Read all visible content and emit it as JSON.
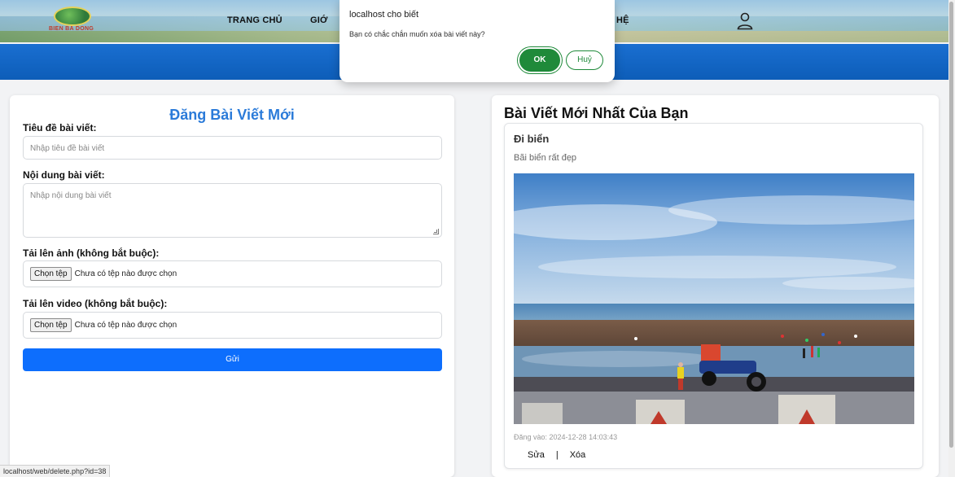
{
  "header": {
    "logo_text": "BIEN BA DONG",
    "nav": [
      "TRANG CHỦ",
      "GIỚ",
      "HỆ"
    ]
  },
  "form": {
    "title": "Đăng Bài Viết Mới",
    "title_label": "Tiêu đề bài viết:",
    "title_placeholder": "Nhập tiêu đề bài viết",
    "content_label": "Nội dung bài viết:",
    "content_placeholder": "Nhập nội dung bài viết",
    "image_label": "Tải lên ảnh (không bắt buộc):",
    "video_label": "Tải lên video (không bắt buộc):",
    "file_button": "Chọn tệp",
    "file_status": "Chưa có tệp nào được chọn",
    "submit_label": "Gửi"
  },
  "recent": {
    "heading": "Bài Viết Mới Nhất Của Bạn",
    "post": {
      "title": "Đi biển",
      "body": "Bãi biển rất đẹp",
      "date": "Đăng vào: 2024-12-28 14:03:43",
      "edit_label": "Sửa",
      "separator": "|",
      "delete_label": "Xóa"
    }
  },
  "dialog": {
    "title": "localhost cho biết",
    "message": "Bạn có chắc chắn muốn xóa bài viết này?",
    "ok_label": "OK",
    "cancel_label": "Huỷ"
  },
  "status_url": "localhost/web/delete.php?id=38",
  "colors": {
    "primary": "#0d6efd",
    "heading_blue": "#2b7bd9",
    "banner_blue": "#1a6fd1",
    "dialog_green": "#1f8a3a"
  }
}
